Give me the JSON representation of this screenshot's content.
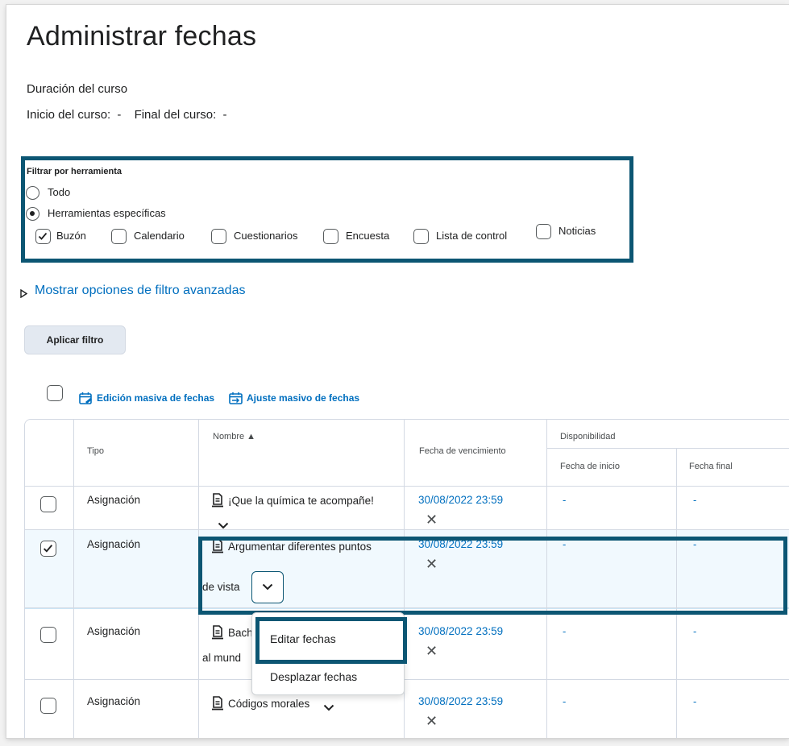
{
  "page": {
    "title": "Administrar fechas"
  },
  "course": {
    "duration_label": "Duración del curso",
    "start_label": "Inicio del curso:",
    "start_value": "-",
    "end_label": "Final del curso:",
    "end_value": "-"
  },
  "filter": {
    "heading": "Filtrar por herramienta",
    "options": [
      {
        "label": "Todo",
        "selected": false
      },
      {
        "label": "Herramientas específicas",
        "selected": true
      }
    ],
    "tools": [
      {
        "label": "Buzón",
        "checked": true
      },
      {
        "label": "Calendario",
        "checked": false
      },
      {
        "label": "Cuestionarios",
        "checked": false
      },
      {
        "label": "Encuesta",
        "checked": false
      },
      {
        "label": "Lista de control",
        "checked": false
      },
      {
        "label": "Noticias",
        "checked": false
      }
    ],
    "advanced_label": "Mostrar opciones de filtro avanzadas",
    "apply_label": "Aplicar filtro"
  },
  "bulk_actions": {
    "edit_label": "Edición masiva de fechas",
    "adjust_label": "Ajuste masivo de fechas"
  },
  "table": {
    "headers": {
      "type": "Tipo",
      "name": "Nombre ▲",
      "due": "Fecha de vencimiento",
      "availability": "Disponibilidad",
      "start": "Fecha de inicio",
      "end": "Fecha final"
    },
    "rows": [
      {
        "type": "Asignación",
        "name": "¡Que la química te acompañe!",
        "name_line2": "",
        "due": "30/08/2022 23:59",
        "start": "-",
        "end": "-",
        "selected": false
      },
      {
        "type": "Asignación",
        "name": "Argumentar diferentes puntos",
        "name_line2": "de vista",
        "due": "30/08/2022 23:59",
        "start": "-",
        "end": "-",
        "selected": true
      },
      {
        "type": "Asignación",
        "name": "Bach",
        "name_line2": "al mund",
        "due": "30/08/2022 23:59",
        "start": "-",
        "end": "-",
        "selected": false
      },
      {
        "type": "Asignación",
        "name": "Códigos morales",
        "name_line2": "",
        "due": "30/08/2022 23:59",
        "start": "-",
        "end": "-",
        "selected": false
      }
    ]
  },
  "context_menu": {
    "items": [
      "Editar fechas",
      "Desplazar fechas"
    ]
  },
  "icons": {
    "assignment": "assignment-icon",
    "chevron": "chevron-down-icon",
    "clear": "close-icon",
    "triangle": "triangle-right-icon",
    "calendar_edit": "calendar-edit-icon",
    "calendar_shift": "calendar-shift-icon"
  },
  "colors": {
    "link": "#006fbf",
    "highlight": "#0c5673",
    "selected_row": "#f1f9fe"
  }
}
